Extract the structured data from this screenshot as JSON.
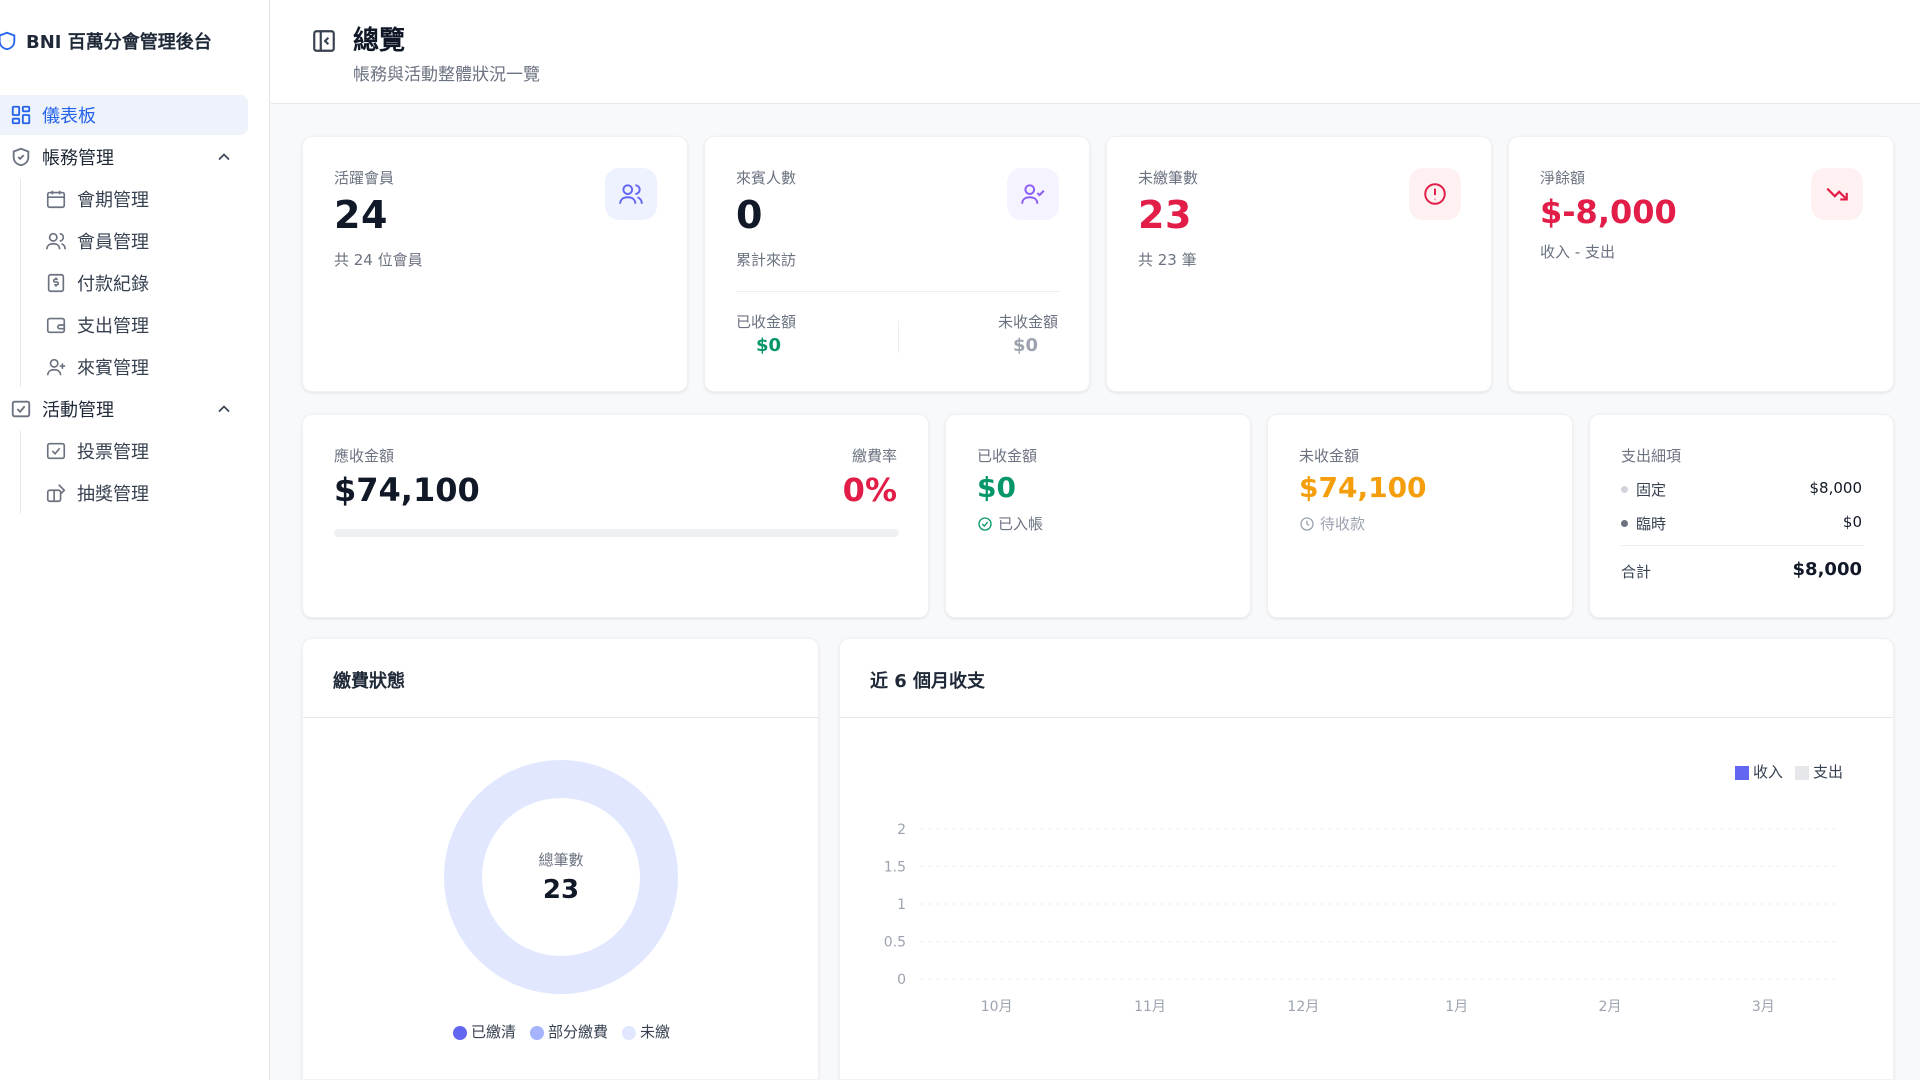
{
  "brand": {
    "title": "BNI 百萬分會管理後台"
  },
  "sidebar": {
    "dashboard": "儀表板",
    "accounts": {
      "label": "帳務管理",
      "items": [
        "會期管理",
        "會員管理",
        "付款紀錄",
        "支出管理",
        "來賓管理"
      ]
    },
    "events": {
      "label": "活動管理",
      "items": [
        "投票管理",
        "抽獎管理"
      ]
    }
  },
  "header": {
    "title": "總覽",
    "subtitle": "帳務與活動整體狀況一覽"
  },
  "stats": {
    "active_members": {
      "label": "活躍會員",
      "value": "24",
      "note": "共 24 位會員"
    },
    "guests": {
      "label": "來賓人數",
      "value": "0",
      "note": "累計來訪",
      "received_label": "已收金額",
      "received_value": "$0",
      "unpaid_label": "未收金額",
      "unpaid_value": "$0"
    },
    "unpaid_count": {
      "label": "未繳筆數",
      "value": "23",
      "note": "共 23 筆"
    },
    "net": {
      "label": "淨餘額",
      "value": "$-8,000",
      "note": "收入 - 支出"
    }
  },
  "finance": {
    "receivable": {
      "label": "應收金額",
      "value": "$74,100",
      "rate_label": "繳費率",
      "rate_value": "0%",
      "rate_fraction": 0
    },
    "received": {
      "label": "已收金額",
      "value": "$0",
      "status": "已入帳"
    },
    "pending": {
      "label": "未收金額",
      "value": "$74,100",
      "status": "待收款"
    },
    "expenses": {
      "label": "支出細項",
      "fixed_label": "固定",
      "fixed_value": "$8,000",
      "temp_label": "臨時",
      "temp_value": "$0",
      "total_label": "合計",
      "total_value": "$8,000"
    }
  },
  "payment_status": {
    "title": "繳費狀態",
    "center_label": "總筆數",
    "center_value": "23",
    "legend": [
      {
        "label": "已繳清",
        "color": "#6366f1",
        "count": 0
      },
      {
        "label": "部分繳費",
        "color": "#a5b4fc",
        "count": 0
      },
      {
        "label": "未繳",
        "color": "#e0e7ff",
        "count": 23
      }
    ]
  },
  "chart_data": {
    "type": "bar",
    "title": "近 6 個月收支",
    "categories": [
      "10月",
      "11月",
      "12月",
      "1月",
      "2月",
      "3月"
    ],
    "series": [
      {
        "name": "收入",
        "color": "#6366f1",
        "values": [
          0,
          0,
          0,
          0,
          0,
          0
        ]
      },
      {
        "name": "支出",
        "color": "#e5e7eb",
        "values": [
          0,
          0,
          0,
          0,
          0,
          0
        ]
      }
    ],
    "yticks": [
      "2",
      "1.5",
      "1",
      "0.5",
      "0"
    ],
    "ylim": [
      0,
      2
    ],
    "grid": true,
    "legend_position": "top-right"
  },
  "colors": {
    "accent": "#2563eb",
    "danger": "#e11d48",
    "success": "#059669",
    "warning": "#f59e0b"
  }
}
